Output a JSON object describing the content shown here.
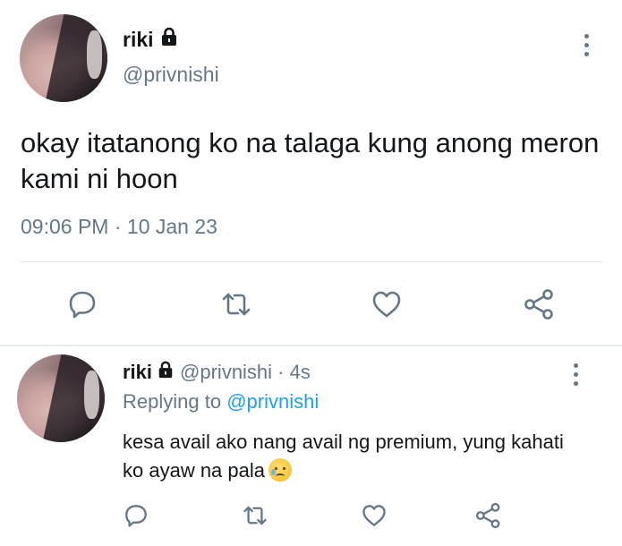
{
  "main_tweet": {
    "name": "riki",
    "handle": "@privnishi",
    "text": "okay itatanong ko na talaga kung anong meron kami ni hoon",
    "time": "09:06 PM",
    "separator": "·",
    "date": "10 Jan 23"
  },
  "reply": {
    "name": "riki",
    "handle": "@privnishi · 4s",
    "replying_prefix": "Replying to",
    "replying_mention": "@privnishi",
    "text": "kesa avail ako nang avail ng premium, yung kahati ko ayaw na pala"
  },
  "icons": {
    "lock": "lock-icon",
    "more": "more-vertical-icon",
    "reply": "reply-icon",
    "retweet": "retweet-icon",
    "like": "heart-icon",
    "share": "share-icon",
    "emoji": "crying-face-emoji"
  },
  "colors": {
    "text": "#14171a",
    "secondary": "#657786",
    "mention": "#1da1f2",
    "divider": "#e1e8ed"
  }
}
